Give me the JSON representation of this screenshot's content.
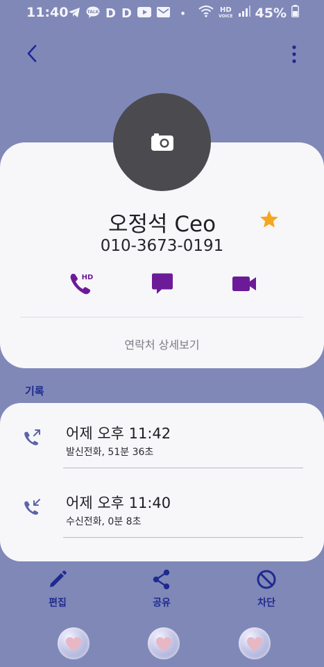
{
  "status_bar": {
    "time": "11:40",
    "app_icons": [
      "telegram-icon",
      "kakaotalk-icon",
      "d-icon",
      "d-icon",
      "youtube-icon",
      "mail-icon"
    ],
    "app_icon_letters": [
      "D",
      "D"
    ],
    "talk_label": "TALK",
    "dot": "•",
    "hd_label": "HD",
    "voice_label": "VOICE",
    "battery": "45%"
  },
  "contact": {
    "name": "오정석 Ceo",
    "phone": "010-3673-0191",
    "favorite": true,
    "call_hd_label": "HD",
    "details_label": "연락처 상세보기"
  },
  "history": {
    "section_label": "기록",
    "entries": [
      {
        "icon": "outgoing-call-icon",
        "time": "어제 오후 11:42",
        "desc": "발신전화, 51분 36초"
      },
      {
        "icon": "incoming-call-icon",
        "time": "어제 오후 11:40",
        "desc": "수신전화, 0분 8초"
      }
    ]
  },
  "bottom_actions": {
    "edit": "편집",
    "share": "공유",
    "block": "차단"
  },
  "colors": {
    "background": "#8088b8",
    "accent_purple": "#6c1b98",
    "nav_blue": "#1f2a8f",
    "star": "#f5a623",
    "avatar": "#4b4b4f"
  }
}
